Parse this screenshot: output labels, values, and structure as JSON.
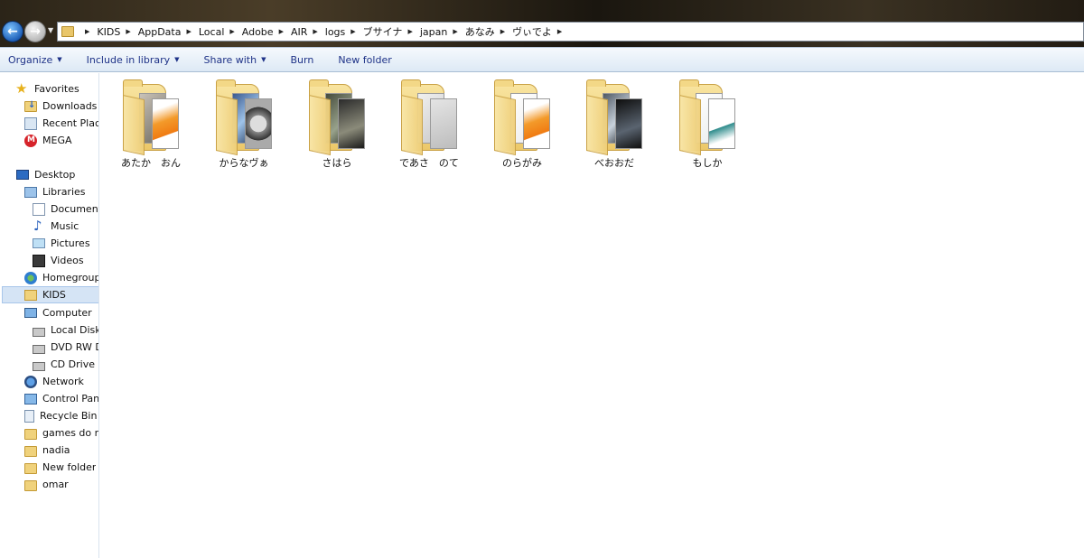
{
  "address_bar": {
    "crumbs": [
      "KIDS",
      "AppData",
      "Local",
      "Adobe",
      "AIR",
      "logs",
      "ブサイナ",
      "japan",
      "あなみ",
      "ヴぃでよ"
    ]
  },
  "command_bar": {
    "organize": "Organize",
    "include_in_library": "Include in library",
    "share_with": "Share with",
    "burn": "Burn",
    "new_folder": "New folder"
  },
  "nav_pane": {
    "items": [
      {
        "label": "Favorites",
        "icon": "star-icon"
      },
      {
        "label": "Downloads",
        "icon": "downloads-icon"
      },
      {
        "label": "Recent Places",
        "icon": "recent-places-icon"
      },
      {
        "label": "MEGA",
        "icon": "mega-icon"
      },
      {
        "label": "Desktop",
        "icon": "desktop-icon"
      },
      {
        "label": "Libraries",
        "icon": "libraries-icon"
      },
      {
        "label": "Documents",
        "icon": "documents-icon"
      },
      {
        "label": "Music",
        "icon": "music-icon"
      },
      {
        "label": "Pictures",
        "icon": "pictures-icon"
      },
      {
        "label": "Videos",
        "icon": "videos-icon"
      },
      {
        "label": "Homegroup",
        "icon": "homegroup-icon"
      },
      {
        "label": "KIDS",
        "icon": "user-folder-icon"
      },
      {
        "label": "Computer",
        "icon": "computer-icon"
      },
      {
        "label": "Local Disk (",
        "icon": "local-disk-icon"
      },
      {
        "label": "DVD RW Dr",
        "icon": "dvd-drive-icon"
      },
      {
        "label": "CD Drive (F",
        "icon": "cd-drive-icon"
      },
      {
        "label": "Network",
        "icon": "network-icon"
      },
      {
        "label": "Control Panel",
        "icon": "control-panel-icon"
      },
      {
        "label": "Recycle Bin",
        "icon": "recycle-bin-icon"
      },
      {
        "label": "games do no",
        "icon": "folder-icon"
      },
      {
        "label": "nadia",
        "icon": "folder-icon"
      },
      {
        "label": "New folder",
        "icon": "folder-icon"
      },
      {
        "label": "omar",
        "icon": "folder-icon"
      }
    ],
    "selected": "KIDS"
  },
  "content": {
    "folders": [
      {
        "label": "あたか　おん"
      },
      {
        "label": "からなヴぁ"
      },
      {
        "label": "さはら"
      },
      {
        "label": "であさ　のて"
      },
      {
        "label": "のらがみ"
      },
      {
        "label": "べおおだ"
      },
      {
        "label": "もしか"
      }
    ]
  }
}
